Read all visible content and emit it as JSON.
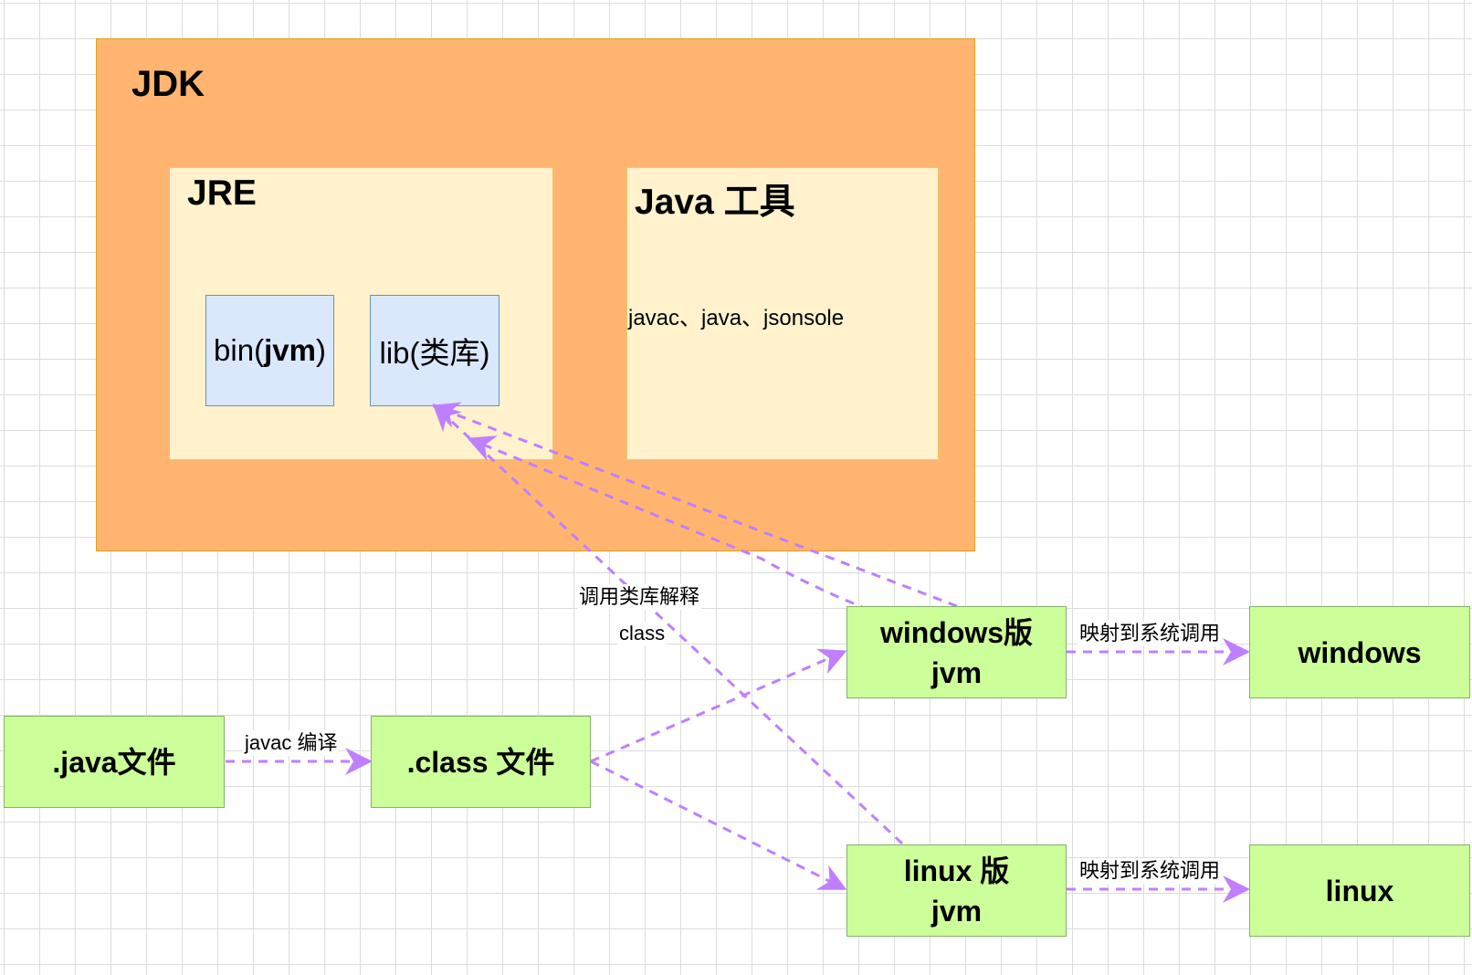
{
  "jdk": {
    "title": "JDK"
  },
  "jre": {
    "title": "JRE",
    "bin_prefix": "bin(",
    "bin_bold": "jvm",
    "bin_suffix": ")",
    "lib_label": "lib(类库)"
  },
  "tools": {
    "title": "Java 工具",
    "items": "javac、java、jsonsole"
  },
  "nodes": {
    "java_file": ".java文件",
    "class_file": ".class 文件",
    "windows_jvm_line1": "windows版",
    "windows_jvm_line2": "jvm",
    "linux_jvm_line1": "linux 版",
    "linux_jvm_line2": "jvm",
    "windows": "windows",
    "linux": "linux"
  },
  "edges": {
    "compile": "javac 编译",
    "lib_call_line1": "调用类库解释",
    "lib_call_line2": "class",
    "map_windows": "映射到系统调用",
    "map_linux": "映射到系统调用"
  },
  "colors": {
    "jdk": "#ffb570",
    "inner": "#fff2cc",
    "blue": "#dae8fc",
    "green": "#ccff99",
    "arrow": "#bf7fff"
  }
}
